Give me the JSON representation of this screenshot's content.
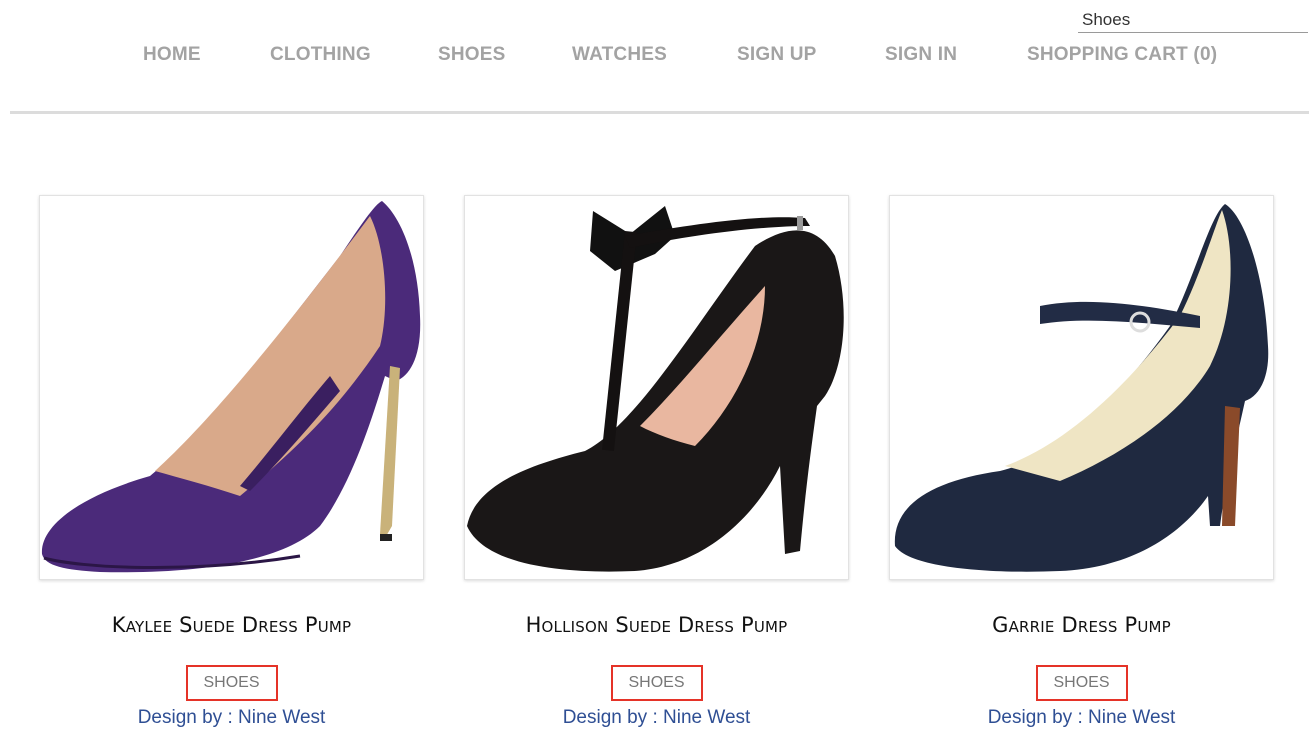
{
  "search": {
    "value": "Shoes"
  },
  "nav": {
    "items": [
      {
        "label": "HOME"
      },
      {
        "label": "CLOTHING"
      },
      {
        "label": "SHOES"
      },
      {
        "label": "WATCHES"
      },
      {
        "label": "SIGN UP"
      },
      {
        "label": "SIGN IN"
      },
      {
        "label": "SHOPPING CART (0)"
      }
    ]
  },
  "products": [
    {
      "name": "Kaylee Suede Dress Pump",
      "category": "SHOES",
      "designer": "Design by : Nine West",
      "color": "#4b2a7a"
    },
    {
      "name": "Hollison Suede Dress Pump",
      "category": "SHOES",
      "designer": "Design by : Nine West",
      "color": "#1a1717"
    },
    {
      "name": "Garrie Dress Pump",
      "category": "SHOES",
      "designer": "Design by : Nine West",
      "color": "#1f2940"
    }
  ],
  "colors": {
    "nav_text": "#a3a3a3",
    "highlight_border": "#e53328",
    "designer_link": "#2f4f94"
  }
}
